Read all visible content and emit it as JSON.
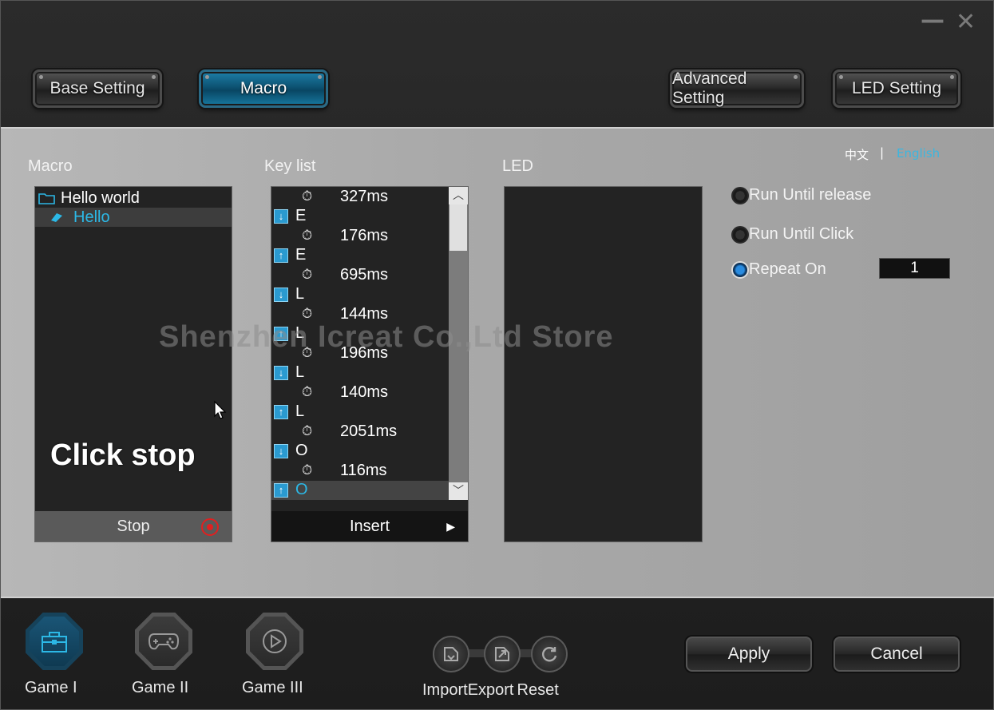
{
  "window": {
    "minimize_glyph": "—",
    "close_glyph": "✕"
  },
  "tabs": [
    {
      "label": "Base Setting",
      "active": false
    },
    {
      "label": "Macro",
      "active": true
    },
    {
      "label": "Advanced Setting",
      "active": false
    },
    {
      "label": "LED Setting",
      "active": false
    }
  ],
  "language": {
    "chinese": "中文",
    "separator": "|",
    "english": "English"
  },
  "macro_panel": {
    "title": "Macro",
    "folder": "Hello world",
    "selected_item": "Hello",
    "stop_label": "Stop"
  },
  "key_list": {
    "title": "Key list",
    "rows": [
      {
        "type": "delay",
        "text": "327ms"
      },
      {
        "type": "down",
        "text": "E"
      },
      {
        "type": "delay",
        "text": "176ms"
      },
      {
        "type": "up",
        "text": "E"
      },
      {
        "type": "delay",
        "text": "695ms"
      },
      {
        "type": "down",
        "text": "L"
      },
      {
        "type": "delay",
        "text": "144ms"
      },
      {
        "type": "up",
        "text": "L"
      },
      {
        "type": "delay",
        "text": "196ms"
      },
      {
        "type": "down",
        "text": "L"
      },
      {
        "type": "delay",
        "text": "140ms"
      },
      {
        "type": "up",
        "text": "L"
      },
      {
        "type": "delay",
        "text": "2051ms"
      },
      {
        "type": "down",
        "text": "O"
      },
      {
        "type": "delay",
        "text": "116ms"
      },
      {
        "type": "up",
        "text": "O",
        "selected": true
      }
    ],
    "insert_label": "Insert"
  },
  "led_panel": {
    "title": "LED"
  },
  "options": {
    "run_until_release": "Run Until release",
    "run_until_click": "Run Until Click",
    "repeat_on": "Repeat On",
    "repeat_count": "1",
    "selected": "repeat_on"
  },
  "watermark": "Shenzhen Icreat Co.,Ltd Store",
  "overlay_caption": "Click stop",
  "games": [
    {
      "label": "Game I",
      "active": true
    },
    {
      "label": "Game II",
      "active": false
    },
    {
      "label": "Game III",
      "active": false
    }
  ],
  "tools": {
    "import_label": "Import",
    "export_label": "Export",
    "reset_label": "Reset"
  },
  "actions": {
    "apply_label": "Apply",
    "cancel_label": "Cancel"
  },
  "colors": {
    "accent": "#2cb8e6",
    "stop_red": "#e02020"
  }
}
